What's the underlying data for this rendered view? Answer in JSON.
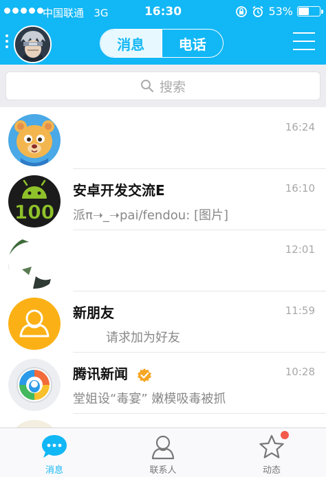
{
  "status": {
    "carrier": "中国联通",
    "network": "3G",
    "time": "16:30",
    "battery": "53%",
    "battery_level": 0.53
  },
  "header": {
    "tab_messages": "消息",
    "tab_calls": "电话"
  },
  "search": {
    "placeholder": "搜索"
  },
  "conversations": [
    {
      "name": "",
      "message": "",
      "time": "16:24",
      "avatar": "bear-avatar"
    },
    {
      "name": "安卓开发交流E",
      "message": "派π➝_➝pai/fendou: [图片]",
      "time": "16:10",
      "avatar": "android-100-avatar"
    },
    {
      "name": "",
      "message": "",
      "time": "12:01",
      "avatar": "blurred-avatar"
    },
    {
      "name": "新朋友",
      "message": "请求加为好友",
      "time": "11:59",
      "avatar": "new-friend-avatar"
    },
    {
      "name": "腾讯新闻",
      "message": "堂姐设“毒宴” 嫩模吸毒被抓",
      "time": "10:28",
      "avatar": "tencent-news-avatar"
    }
  ],
  "tabs": [
    {
      "label": "消息",
      "icon": "chat-bubble-icon"
    },
    {
      "label": "联系人",
      "icon": "contacts-icon"
    },
    {
      "label": "动态",
      "icon": "star-icon"
    }
  ],
  "colors": {
    "brand": "#12b7f5",
    "badge_red": "#f35a4a",
    "new_friend": "#fbb116"
  }
}
